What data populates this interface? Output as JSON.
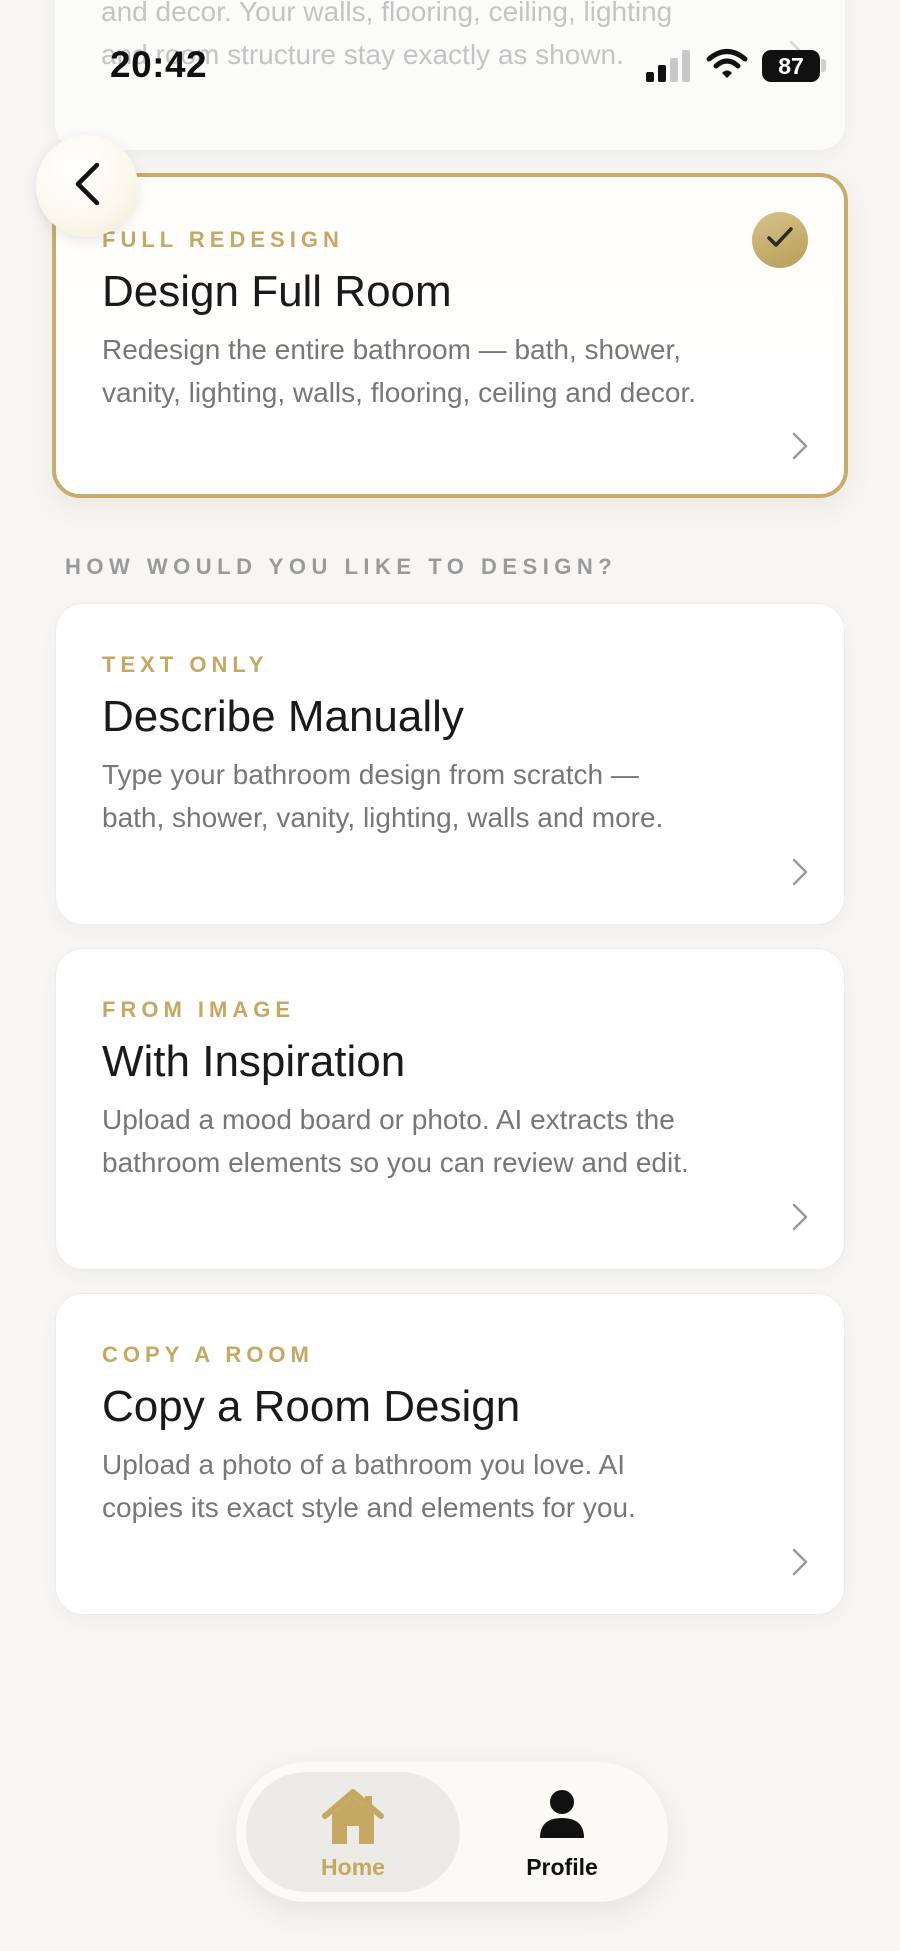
{
  "status_bar": {
    "time": "20:42",
    "battery": "87"
  },
  "previous_card": {
    "description": "and decor. Your walls, flooring, ceiling, lighting and room structure stay exactly as shown."
  },
  "selected_card": {
    "eyebrow": "FULL REDESIGN",
    "title": "Design Full Room",
    "description": "Redesign the entire bathroom — bath, shower, vanity, lighting, walls, flooring, ceiling and decor."
  },
  "section_label": "HOW WOULD YOU LIKE TO DESIGN?",
  "options": [
    {
      "eyebrow": "TEXT ONLY",
      "title": "Describe Manually",
      "description": "Type your bathroom design from scratch — bath, shower, vanity, lighting, walls and more."
    },
    {
      "eyebrow": "FROM IMAGE",
      "title": "With Inspiration",
      "description": "Upload a mood board or photo. AI extracts the bathroom elements so you can review and edit."
    },
    {
      "eyebrow": "COPY A ROOM",
      "title": "Copy a Room Design",
      "description": "Upload a photo of a bathroom you love. AI copies its exact style and elements for you."
    }
  ],
  "tabbar": {
    "home_label": "Home",
    "profile_label": "Profile"
  },
  "colors": {
    "accent_gold": "#c5a862",
    "selected_border": "#c7ad68",
    "background": "#f7f6f4"
  }
}
